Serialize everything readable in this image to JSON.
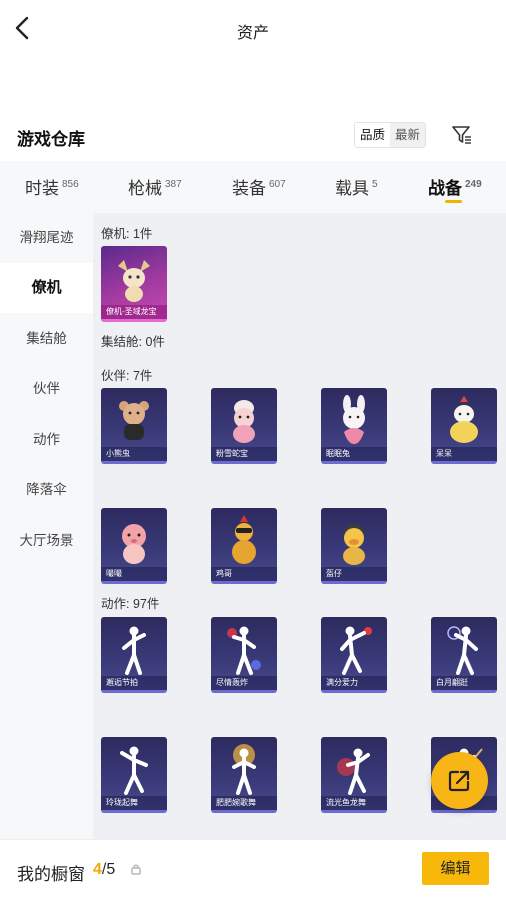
{
  "header": {
    "title": "资产"
  },
  "section": {
    "title": "游戏仓库",
    "sort_quality": "品质",
    "sort_newest": "最新"
  },
  "tabs": [
    {
      "label": "时装",
      "count": "856"
    },
    {
      "label": "枪械",
      "count": "387"
    },
    {
      "label": "装备",
      "count": "607"
    },
    {
      "label": "载具",
      "count": "5"
    },
    {
      "label": "战备",
      "count": "249"
    }
  ],
  "sidebar": {
    "items": [
      {
        "label": "滑翔尾迹"
      },
      {
        "label": "僚机"
      },
      {
        "label": "集结舱"
      },
      {
        "label": "伙伴"
      },
      {
        "label": "动作"
      },
      {
        "label": "降落伞"
      },
      {
        "label": "大厅场景"
      }
    ]
  },
  "groups": {
    "wingman": {
      "label": "僚机: 1件",
      "items": [
        {
          "name": "僚机-圣域龙宝"
        }
      ]
    },
    "capsule": {
      "label": "集结舱: 0件"
    },
    "partner": {
      "label": "伙伴: 7件",
      "items": [
        {
          "name": "小熊虫"
        },
        {
          "name": "粉雪蛇宝"
        },
        {
          "name": "眠眠兔"
        },
        {
          "name": "呆呆"
        },
        {
          "name": "嘬嘬"
        },
        {
          "name": "鸡哥"
        },
        {
          "name": "盔仔"
        }
      ]
    },
    "emote": {
      "label": "动作: 97件",
      "items": [
        {
          "name": "邂逅节拍"
        },
        {
          "name": "尽情轰炸"
        },
        {
          "name": "满分爱力"
        },
        {
          "name": "白月翩跹"
        },
        {
          "name": "玲珑起舞"
        },
        {
          "name": "肥肥婉歌舞"
        },
        {
          "name": "流光鱼龙舞"
        },
        {
          "name": ""
        }
      ]
    }
  },
  "bottom": {
    "label": "我的橱窗",
    "current": "4",
    "total": "5",
    "edit_label": "编辑"
  },
  "colors": {
    "accent": "#f8b80a",
    "card_bg": "#2d2a5e",
    "legendary_bg": "#a23aa0"
  },
  "icons": {
    "back": "chevron-left-icon",
    "filter": "filter-icon",
    "share": "share-external-icon",
    "lock": "lock-icon"
  }
}
